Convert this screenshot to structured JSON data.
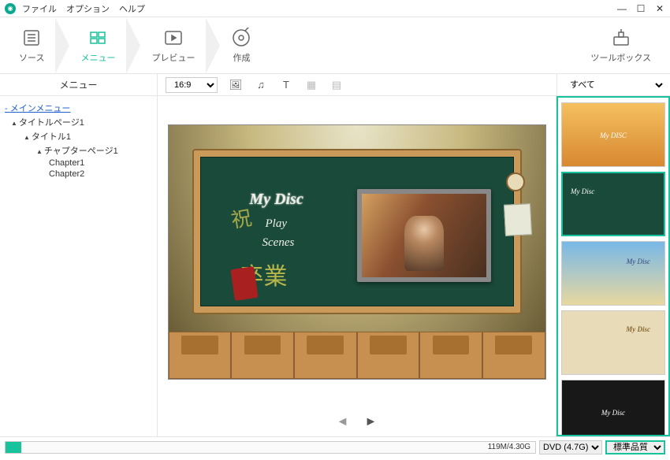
{
  "menubar": {
    "file": "ファイル",
    "options": "オプション",
    "help": "ヘルプ"
  },
  "steps": {
    "source": "ソース",
    "menu": "メニュー",
    "preview": "プレビュー",
    "create": "作成",
    "toolbox": "ツールボックス"
  },
  "secondary": {
    "tree_header": "メニュー",
    "aspect": "16:9",
    "template_filter": "すべて"
  },
  "tree": {
    "main_menu": "メインメニュー",
    "title_page": "タイトルページ1",
    "title": "タイトル1",
    "chapter_page": "チャプターページ1",
    "chapter1": "Chapter1",
    "chapter2": "Chapter2"
  },
  "disc_menu": {
    "title": "My Disc",
    "play": "Play",
    "scenes": "Scenes",
    "kanji1": "祝",
    "kanji2": "卒業"
  },
  "templates": [
    {
      "name": "party",
      "title": "My DISC"
    },
    {
      "name": "classroom",
      "title": "My Disc"
    },
    {
      "name": "beach",
      "title": "My Disc"
    },
    {
      "name": "vintage",
      "title": "My Disc"
    },
    {
      "name": "dark",
      "title": "My Disc"
    }
  ],
  "bottom": {
    "size": "119M/4.30G",
    "disc_type": "DVD (4.7G)",
    "quality": "標準品質"
  }
}
